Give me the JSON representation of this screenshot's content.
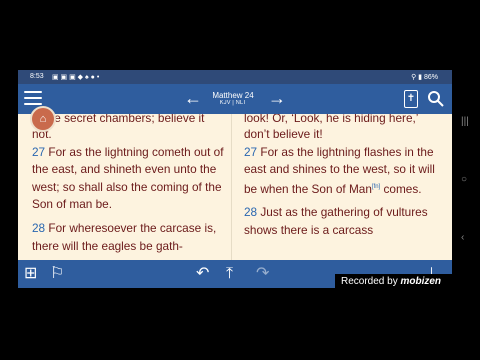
{
  "status": {
    "time": "8:53",
    "battery": "86%"
  },
  "header": {
    "book": "Matthew 24",
    "versions": "KJV | NLT",
    "prev_icon": "arrow-left-icon",
    "next_icon": "arrow-right-icon"
  },
  "left_column": {
    "clip": "in the secret chambers; believe it",
    "clip2": "not.",
    "v27_num": "27",
    "v27_text": "For as the lightning cometh out of the east, and shineth even unto the west; so shall also the coming of the Son of man be.",
    "v28_num": "28",
    "v28_text": "For wheresoever the carcase is, there will the eagles be gath-"
  },
  "right_column": {
    "clip": "look! Or, ‘Look, he is hiding here,’",
    "clip2": "don’t believe it!",
    "v27_num": "27",
    "v27_text_a": "For as the lightning flashes in the east and shines to the west, so it will be when the Son of Man",
    "v27_fn": "[fn]",
    "v27_text_b": " comes.",
    "v28_num": "28",
    "v28_text": "Just as the gathering of vultures shows there is a carcass"
  },
  "watermark": {
    "text": "Recorded by",
    "brand": "mobizen"
  }
}
